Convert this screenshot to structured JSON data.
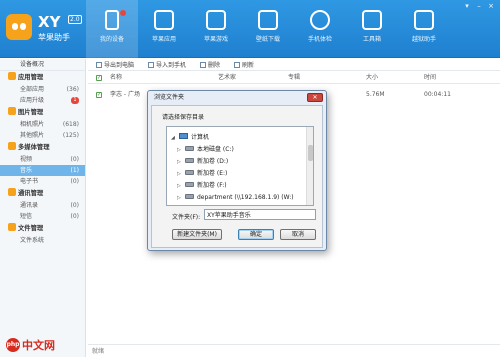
{
  "app": {
    "logo_text": "XY",
    "version": "2.0",
    "name": "苹果助手"
  },
  "nav": [
    {
      "label": "我的设备",
      "icon": "phone-icon",
      "active": true,
      "dot": true
    },
    {
      "label": "苹果应用",
      "icon": "apps-icon"
    },
    {
      "label": "苹果游戏",
      "icon": "game-icon"
    },
    {
      "label": "壁纸下载",
      "icon": "wallpaper-icon"
    },
    {
      "label": "手机体检",
      "icon": "checkup-icon"
    },
    {
      "label": "工具箱",
      "icon": "toolbox-icon"
    },
    {
      "label": "越狱助手",
      "icon": "jailbreak-icon"
    }
  ],
  "sidebar": {
    "device_overview": "设备概况",
    "groups": [
      {
        "label": "应用管理",
        "items": [
          {
            "label": "全部应用",
            "count": "(36)"
          },
          {
            "label": "应用升级",
            "badge": "1"
          }
        ]
      },
      {
        "label": "图片管理",
        "items": [
          {
            "label": "相机照片",
            "count": "(618)"
          },
          {
            "label": "其他照片",
            "count": "(125)"
          }
        ]
      },
      {
        "label": "多媒体管理",
        "items": [
          {
            "label": "视频",
            "count": "(0)"
          },
          {
            "label": "音乐",
            "count": "(1)",
            "selected": true
          },
          {
            "label": "电子书",
            "count": "(0)"
          }
        ]
      },
      {
        "label": "通讯管理",
        "items": [
          {
            "label": "通讯录",
            "count": "(0)"
          },
          {
            "label": "短信",
            "count": "(0)"
          }
        ]
      },
      {
        "label": "文件管理",
        "items": [
          {
            "label": "文件系统"
          }
        ]
      }
    ]
  },
  "toolbar": {
    "export_pc": "导出到电脑",
    "import_phone": "导入到手机",
    "delete": "删除",
    "refresh": "刷新"
  },
  "table": {
    "headers": {
      "name": "名称",
      "artist": "艺术家",
      "album": "专辑",
      "size": "大小",
      "time": "时间"
    },
    "rows": [
      {
        "name": "李志 - 广场",
        "size": "5.76M",
        "time": "00:04:11"
      }
    ]
  },
  "status": {
    "text": "就绪"
  },
  "dialog": {
    "title": "浏览文件夹",
    "close": "✕",
    "prompt": "请选择保存目录",
    "tree": [
      {
        "label": "计算机",
        "type": "pc",
        "expanded": true
      },
      {
        "label": "本地磁盘 (C:)",
        "type": "drive"
      },
      {
        "label": "新加卷 (D:)",
        "type": "drive"
      },
      {
        "label": "新加卷 (E:)",
        "type": "drive"
      },
      {
        "label": "新加卷 (F:)",
        "type": "drive"
      },
      {
        "label": "department (\\\\192.168.1.9) (W:)",
        "type": "net"
      }
    ],
    "folder_label": "文件夹(F):",
    "folder_value": "XY苹果助手音乐",
    "new_folder": "新建文件夹(M)",
    "ok": "确定",
    "cancel": "取消"
  },
  "watermark": {
    "logo": "php",
    "text": "中文网"
  }
}
